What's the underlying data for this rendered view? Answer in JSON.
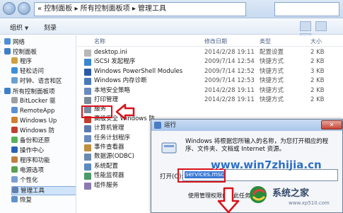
{
  "window": {
    "address_text": "« 控制面板 ▸ 所有控制面板项 ▸ 管理工具"
  },
  "toolbar": {
    "organize": "组织",
    "burn": "刻录"
  },
  "columns": {
    "name": "名称",
    "date": "修改日期",
    "type": "类型",
    "size": "大小"
  },
  "nav": {
    "items": [
      {
        "label": "网络",
        "icon": "network-icon",
        "color": "#4d8fd6"
      },
      {
        "label": "控制面板",
        "icon": "control-panel-icon",
        "color": "#3f7fc9"
      },
      {
        "label": "程序",
        "icon": "programs-icon",
        "color": "#d0a040"
      },
      {
        "label": "轻松访问",
        "icon": "accessibility-icon",
        "color": "#3c8fd8"
      },
      {
        "label": "时钟、语言和区",
        "icon": "clock-icon",
        "color": "#6aa0d0"
      },
      {
        "label": "所有控制面板项",
        "icon": "control-panel-icon",
        "color": "#3f7fc9"
      },
      {
        "label": "BitLocker 驱",
        "icon": "bitlocker-icon",
        "color": "#a0a0a0"
      },
      {
        "label": "RemoteApp",
        "icon": "remoteapp-icon",
        "color": "#5a8fd0"
      },
      {
        "label": "Windows Up",
        "icon": "update-icon",
        "color": "#d08030"
      },
      {
        "label": "Windows 防",
        "icon": "firewall-icon",
        "color": "#c04030"
      },
      {
        "label": "备份和还原",
        "icon": "backup-icon",
        "color": "#5ab05a"
      },
      {
        "label": "操作中心",
        "icon": "flag-icon",
        "color": "#2a62b4"
      },
      {
        "label": "程序和功能",
        "icon": "programs-icon",
        "color": "#c08040"
      },
      {
        "label": "电源选项",
        "icon": "power-icon",
        "color": "#5aa050"
      },
      {
        "label": "个性化",
        "icon": "personalize-icon",
        "color": "#7a9fd0"
      },
      {
        "label": "管理工具",
        "icon": "admin-tools-icon",
        "color": "#6080b0"
      },
      {
        "label": "恢复",
        "icon": "recovery-icon",
        "color": "#6090c8"
      }
    ]
  },
  "files": [
    {
      "name": "desktop.ini",
      "date": "2014/2/28 19:11",
      "type": "配置设置",
      "size": "2 KB",
      "icon": "ini-file-icon",
      "color": "#b8b8b8"
    },
    {
      "name": "iSCSI 发起程序",
      "date": "2009/7/14 12:54",
      "type": "快捷方式",
      "size": "2 KB",
      "icon": "iscsi-icon",
      "color": "#3a88d0"
    },
    {
      "name": "Windows PowerShell Modules",
      "date": "2009/7/14 12:52",
      "type": "快捷方式",
      "size": "3 KB",
      "icon": "powershell-icon",
      "color": "#2a5aa8"
    },
    {
      "name": "Windows 内存诊断",
      "date": "2009/7/14 12:53",
      "type": "快捷方式",
      "size": "2 KB",
      "icon": "memory-diag-icon",
      "color": "#4a7ab8"
    },
    {
      "name": "本地安全策略",
      "date": "2014/2/28 19:11",
      "type": "快捷方式",
      "size": "2 KB",
      "icon": "security-policy-icon",
      "color": "#6a8ac0"
    },
    {
      "name": "打印管理",
      "date": "2014/2/28 19:11",
      "type": "快捷方式",
      "size": "2 KB",
      "icon": "print-icon",
      "color": "#7a8a9a"
    },
    {
      "name": "服务",
      "date": "",
      "type": "",
      "size": "",
      "icon": "services-icon",
      "color": "#7a8aa0"
    },
    {
      "name": "高级安全 Windows 防",
      "date": "",
      "type": "",
      "size": "",
      "icon": "firewall-icon",
      "color": "#c04030"
    },
    {
      "name": "计算机管理",
      "date": "",
      "type": "",
      "size": "",
      "icon": "computer-mgmt-icon",
      "color": "#5a7ab0"
    },
    {
      "name": "任务计划程序",
      "date": "",
      "type": "",
      "size": "",
      "icon": "task-scheduler-icon",
      "color": "#6a8ac0"
    },
    {
      "name": "事件查看器",
      "date": "",
      "type": "",
      "size": "",
      "icon": "event-viewer-icon",
      "color": "#c09040"
    },
    {
      "name": "数据源(ODBC)",
      "date": "",
      "type": "",
      "size": "",
      "icon": "odbc-icon",
      "color": "#6a8ab0"
    },
    {
      "name": "系统配置",
      "date": "",
      "type": "",
      "size": "",
      "icon": "sysconfig-icon",
      "color": "#5a8ac0"
    },
    {
      "name": "性能监视器",
      "date": "",
      "type": "",
      "size": "",
      "icon": "perf-monitor-icon",
      "color": "#4a9a6a"
    },
    {
      "name": "组件服务",
      "date": "",
      "type": "",
      "size": "",
      "icon": "component-services-icon",
      "color": "#8a7ab0"
    }
  ],
  "run_dialog": {
    "title": "运行",
    "description": "Windows 将根据您所输入的名称，为您打开相应的程序、文件夹、文档或 Internet 资源。",
    "open_label": "打开(O):",
    "input_value": "services.msc",
    "admin_text": "使用管理权限创建此任务。"
  },
  "watermark": {
    "url": "www.win7zhijia.cn",
    "brand": "系统之家",
    "brand_url": "www.xp510.com"
  },
  "colors": {
    "highlight": "#d8121b",
    "accent": "#3a78d4"
  }
}
